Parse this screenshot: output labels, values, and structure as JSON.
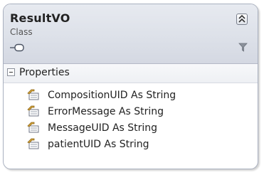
{
  "class_shape": {
    "title": "ResultVO",
    "subtitle": "Class"
  },
  "compartment": {
    "label": "Properties",
    "items": [
      "CompositionUID As String",
      "ErrorMessage As String",
      "MessageUID As String",
      "patientUID As String"
    ]
  },
  "icons": {
    "collapse": "double-chevron-up-icon",
    "interface": "lollipop-interface-icon",
    "filter": "funnel-filter-icon",
    "property": "property-icon"
  },
  "colors": {
    "header_bg": "#dde1e9",
    "border": "#a9b0bf"
  }
}
